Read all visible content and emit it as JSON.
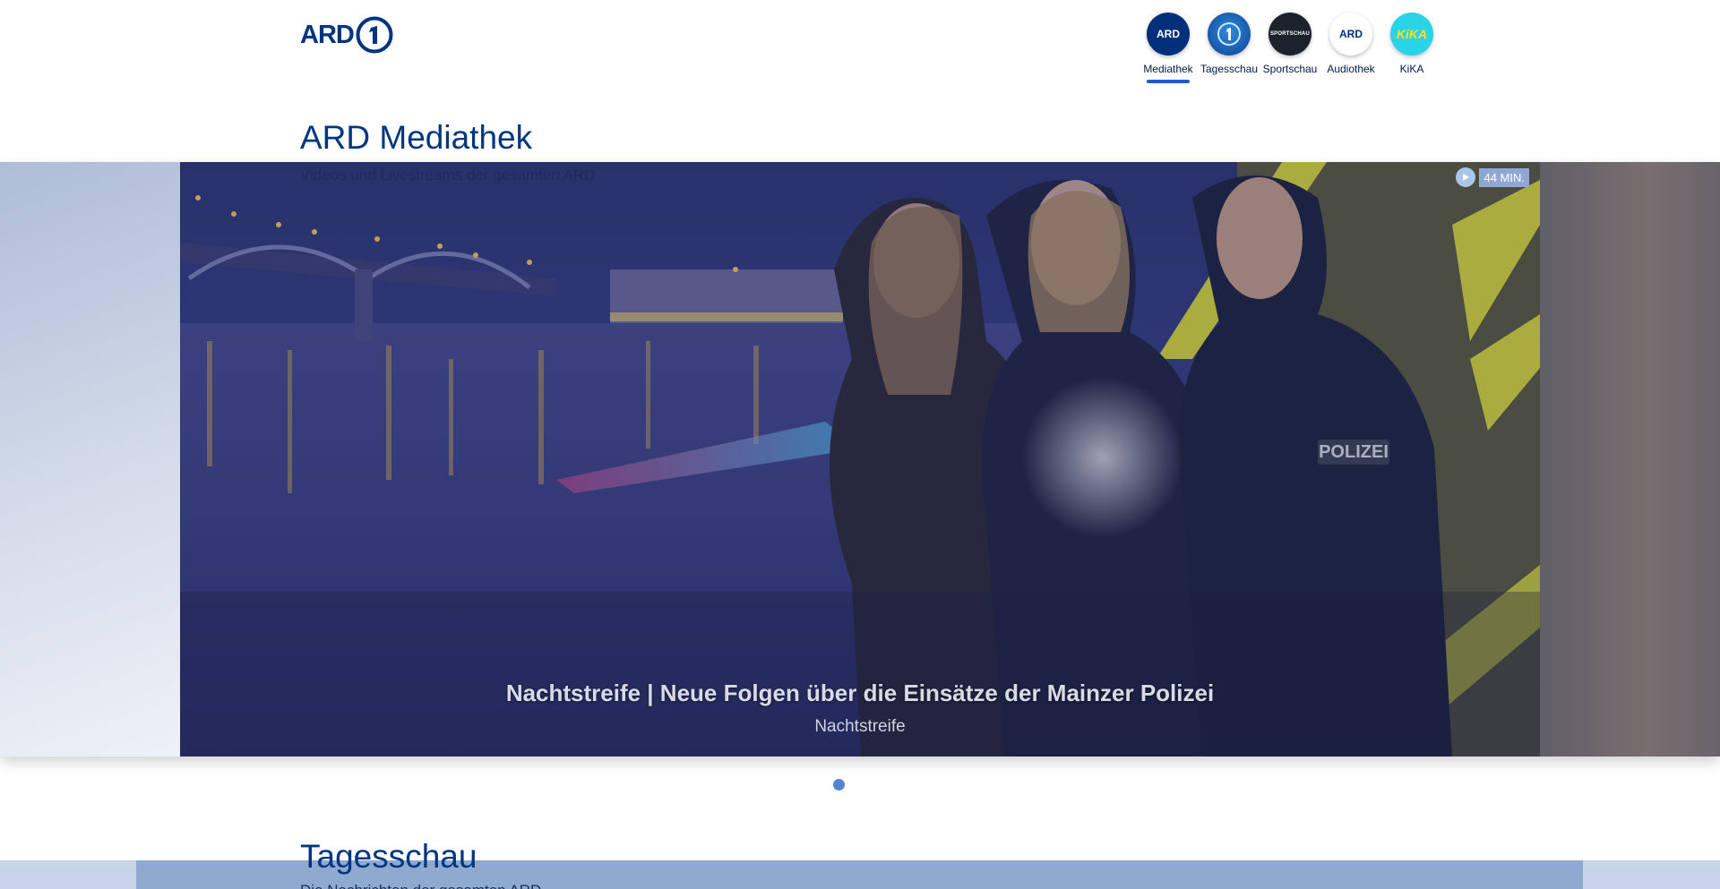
{
  "header": {
    "logo": {
      "text": "ARD",
      "icon": "ard-one-icon"
    },
    "brands": [
      {
        "label": "Mediathek",
        "badge": "ARD",
        "active": true
      },
      {
        "label": "Tagesschau",
        "badge": "",
        "active": false
      },
      {
        "label": "Sportschau",
        "badge": "SPORTSCHAU",
        "active": false
      },
      {
        "label": "Audiothek",
        "badge": "ARD",
        "active": false
      },
      {
        "label": "KiKA",
        "badge": "KiKA",
        "active": false
      }
    ]
  },
  "hero_section": {
    "title": "ARD Mediathek",
    "subtitle": "Videos und Livestreams der gesamten ARD"
  },
  "hero_slide": {
    "duration": "44 MIN.",
    "title": "Nachtstreife | Neue Folgen über die Einsätze der Mainzer Polizei",
    "subtitle": "Nachtstreife",
    "badge_text": "POLIZEI"
  },
  "next_section": {
    "title": "Tagesschau",
    "subtitle": "Die Nachrichten der gesamten ARD"
  },
  "colors": {
    "brand_blue": "#00367f",
    "accent": "#1f5cc6",
    "dot": "#5585d1"
  }
}
